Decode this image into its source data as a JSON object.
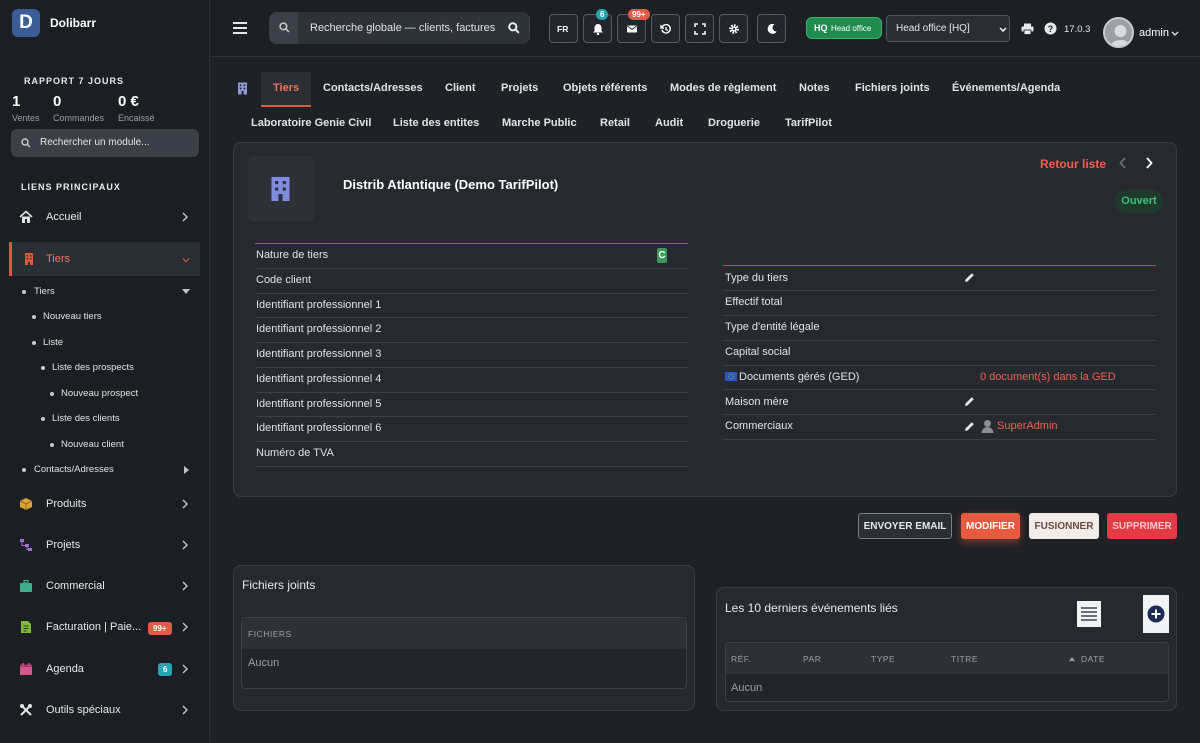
{
  "app": {
    "name": "Dolibarr",
    "logo_letter": "D"
  },
  "sidebar": {
    "report_title": "RAPPORT 7 JOURS",
    "stats": [
      {
        "value": "1",
        "label": "Ventes"
      },
      {
        "value": "0",
        "label": "Commandes"
      },
      {
        "value": "0 €",
        "label": "Encaissé"
      }
    ],
    "module_search_placeholder": "Rechercher un module...",
    "links_title": "LIENS PRINCIPAUX",
    "items": [
      {
        "label": "Accueil",
        "icon": "home-icon"
      },
      {
        "label": "Tiers",
        "icon": "building-icon",
        "active": true
      },
      {
        "label": "Produits",
        "icon": "box-icon"
      },
      {
        "label": "Projets",
        "icon": "project-icon"
      },
      {
        "label": "Commercial",
        "icon": "briefcase-icon"
      },
      {
        "label": "Facturation | Paie...",
        "icon": "invoice-icon",
        "badge": "99+"
      },
      {
        "label": "Agenda",
        "icon": "calendar-icon",
        "badge": "6"
      },
      {
        "label": "Outils spéciaux",
        "icon": "tools-icon"
      }
    ],
    "subitems": {
      "tiers": "Tiers",
      "nouveau_tiers": "Nouveau tiers",
      "liste": "Liste",
      "liste_prospects": "Liste des prospects",
      "nouveau_prospect": "Nouveau prospect",
      "liste_clients": "Liste des clients",
      "nouveau_client": "Nouveau client",
      "contacts": "Contacts/Adresses"
    }
  },
  "topbar": {
    "search_placeholder": "Recherche globale — clients, factures",
    "lang": "FR",
    "notif_count": "6",
    "mail_count": "99+",
    "hq_short": "HQ",
    "hq_label": "Head office",
    "entity": "Head office [HQ]",
    "version": "17.0.3",
    "user": "admin"
  },
  "tabs": {
    "row1": [
      "Tiers",
      "Contacts/Adresses",
      "Client",
      "Projets",
      "Objets référents",
      "Modes de règlement",
      "Notes",
      "Fichiers joints",
      "Événements/Agenda"
    ],
    "row2": [
      "Laboratoire Genie Civil",
      "Liste des entites",
      "Marche Public",
      "Retail",
      "Audit",
      "Droguerie",
      "TarifPilot"
    ]
  },
  "thirdparty": {
    "name": "Distrib Atlantique (Demo TarifPilot)",
    "back_link": "Retour liste",
    "status": "Ouvert",
    "left_fields": [
      {
        "label": "Nature de tiers",
        "value": "C"
      },
      {
        "label": "Code client",
        "value": ""
      },
      {
        "label": "Identifiant professionnel 1",
        "value": ""
      },
      {
        "label": "Identifiant professionnel 2",
        "value": ""
      },
      {
        "label": "Identifiant professionnel 3",
        "value": ""
      },
      {
        "label": "Identifiant professionnel 4",
        "value": ""
      },
      {
        "label": "Identifiant professionnel 5",
        "value": ""
      },
      {
        "label": "Identifiant professionnel 6",
        "value": ""
      },
      {
        "label": "Numéro de TVA",
        "value": ""
      }
    ],
    "right_fields": [
      {
        "label": "Type du tiers",
        "value": ""
      },
      {
        "label": "Effectif total",
        "value": ""
      },
      {
        "label": "Type d'entité légale",
        "value": ""
      },
      {
        "label": "Capital social",
        "value": ""
      },
      {
        "label": "Documents gérés (GED)",
        "value": "0 document(s) dans la GED"
      },
      {
        "label": "Maison mère",
        "value": ""
      },
      {
        "label": "Commerciaux",
        "value": "SuperAdmin"
      }
    ]
  },
  "actions": {
    "email": "ENVOYER EMAIL",
    "modify": "MODIFIER",
    "merge": "FUSIONNER",
    "delete": "SUPPRIMER"
  },
  "files": {
    "title": "Fichiers joints",
    "col": "FICHIERS",
    "empty": "Aucun"
  },
  "events": {
    "title": "Les 10 derniers événements liés",
    "cols": [
      "RÉF.",
      "PAR",
      "TYPE",
      "TITRE",
      "DATE"
    ],
    "empty": "Aucun"
  },
  "colors": {
    "accent": "#e0593d",
    "link": "#f2624a",
    "success": "#1f8c4e",
    "info": "#2aa3b8"
  }
}
